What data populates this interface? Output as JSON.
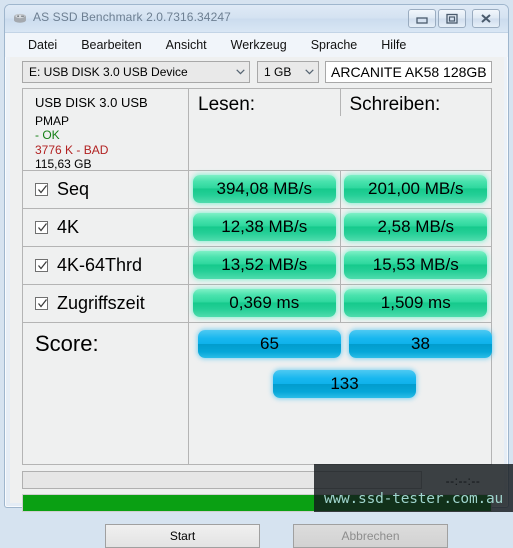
{
  "window": {
    "title": "AS SSD Benchmark 2.0.7316.34247",
    "icon": "hard-drive-icon",
    "minimize_label": "Minimize",
    "maximize_label": "Restore",
    "close_label": "Close"
  },
  "menu": {
    "items": [
      {
        "label": "Datei"
      },
      {
        "label": "Bearbeiten"
      },
      {
        "label": "Ansicht"
      },
      {
        "label": "Werkzeug"
      },
      {
        "label": "Sprache"
      },
      {
        "label": "Hilfe"
      }
    ]
  },
  "selection": {
    "drive": "E: USB DISK 3.0 USB Device",
    "test_size": "1 GB",
    "device_name": "ARCANITE AK58 128GB"
  },
  "drive_info": {
    "model": "USB DISK 3.0 USB",
    "firmware": "PMAP",
    "alignment_status": "- OK",
    "partition_status": "3776 K - BAD",
    "capacity": "115,63 GB"
  },
  "columns": {
    "read": "Lesen:",
    "write": "Schreiben:"
  },
  "rows": [
    {
      "id": "seq",
      "label": "Seq",
      "checked": true,
      "read": "394,08 MB/s",
      "write": "201,00 MB/s"
    },
    {
      "id": "4k",
      "label": "4K",
      "checked": true,
      "read": "12,38 MB/s",
      "write": "2,58 MB/s"
    },
    {
      "id": "4k64thrd",
      "label": "4K-64Thrd",
      "checked": true,
      "read": "13,52 MB/s",
      "write": "15,53 MB/s"
    },
    {
      "id": "zugriffszeit",
      "label": "Zugriffszeit",
      "checked": true,
      "read": "0,369 ms",
      "write": "1,509 ms"
    }
  ],
  "score": {
    "label": "Score:",
    "read": "65",
    "write": "38",
    "total": "133"
  },
  "status": {
    "message": "",
    "timer": "--:--:--",
    "progress_percent": 100
  },
  "buttons": {
    "start": "Start",
    "cancel": "Abbrechen"
  },
  "watermark": {
    "text": "www.ssd-tester.com.au"
  },
  "colors": {
    "pill_green": "#2fd89e",
    "pill_blue": "#0fb2ec",
    "progress_green": "#0aa013",
    "status_ok": "#168016",
    "status_bad": "#b22222"
  },
  "chart_data": {
    "type": "table",
    "title": "AS SSD Benchmark results",
    "categories": [
      "Seq",
      "4K",
      "4K-64Thrd",
      "Zugriffszeit"
    ],
    "series": [
      {
        "name": "Lesen",
        "values": [
          394.08,
          12.38,
          13.52,
          0.369
        ]
      },
      {
        "name": "Schreiben",
        "values": [
          201.0,
          2.58,
          15.53,
          1.509
        ]
      }
    ],
    "units": [
      "MB/s",
      "MB/s",
      "MB/s",
      "ms"
    ],
    "scores": {
      "read": 65,
      "write": 38,
      "total": 133
    }
  }
}
